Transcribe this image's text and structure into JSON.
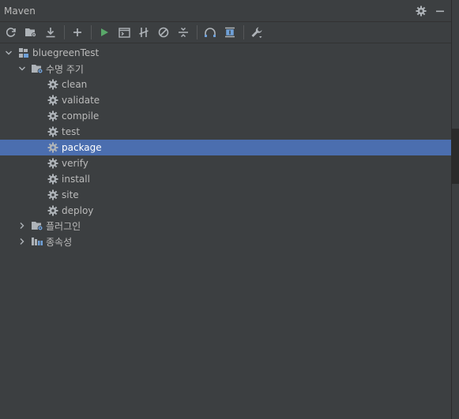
{
  "window": {
    "title": "Maven"
  },
  "toolbar": {
    "items": [
      {
        "icon": "reload-icon"
      },
      {
        "icon": "generate-sources-icon"
      },
      {
        "icon": "download-icon"
      },
      {
        "icon": "add-icon"
      },
      {
        "icon": "run-icon"
      },
      {
        "icon": "execute-goal-icon"
      },
      {
        "icon": "toggle-offline-icon"
      },
      {
        "icon": "skip-tests-icon"
      },
      {
        "icon": "collapse-icon"
      },
      {
        "icon": "show-dependencies-icon"
      },
      {
        "icon": "expand-all-icon"
      },
      {
        "icon": "settings-wrench-icon"
      }
    ]
  },
  "tree": {
    "project": {
      "label": "bluegreenTest",
      "expanded": true
    },
    "lifecycle": {
      "label": "수명 주기",
      "expanded": true,
      "goals": [
        {
          "label": "clean",
          "selected": false
        },
        {
          "label": "validate",
          "selected": false
        },
        {
          "label": "compile",
          "selected": false
        },
        {
          "label": "test",
          "selected": false
        },
        {
          "label": "package",
          "selected": true
        },
        {
          "label": "verify",
          "selected": false
        },
        {
          "label": "install",
          "selected": false
        },
        {
          "label": "site",
          "selected": false
        },
        {
          "label": "deploy",
          "selected": false
        }
      ]
    },
    "plugins": {
      "label": "플러그인",
      "expanded": false
    },
    "dependencies": {
      "label": "종속성",
      "expanded": false
    }
  },
  "colors": {
    "background": "#3c3f41",
    "selection": "#4b6eaf",
    "text": "#bbbbbb",
    "run_green": "#59a869",
    "folder_blue": "#6fa0d8"
  }
}
